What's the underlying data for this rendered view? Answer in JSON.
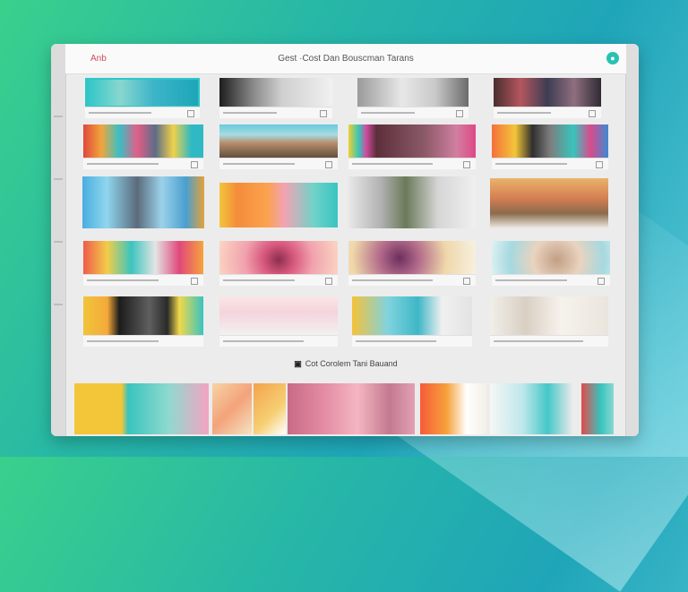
{
  "window": {
    "app_name": "Anb",
    "title": "Gest ·Cost Dan Bouscman Tarans",
    "user_icon": "user-circle-icon"
  },
  "gallery": {
    "section_label": "Cot Corolem Tani Bauand",
    "section_icon": "gallery-icon"
  },
  "colors": {
    "accent": "#29c2b2",
    "app_name": "#d04b5a",
    "window_bg": "#ececec",
    "background_start": "#3ad08c",
    "background_end": "#1fa5b8"
  }
}
